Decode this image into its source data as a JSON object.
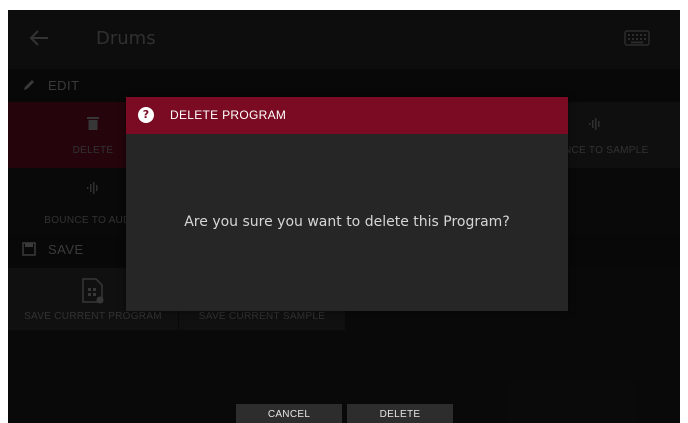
{
  "header": {
    "title": "Drums",
    "back_icon": "arrow-left-icon",
    "keyboard_icon": "keyboard-icon"
  },
  "edit": {
    "label": "EDIT",
    "icon": "pencil-icon",
    "tiles": [
      {
        "label": "DELETE",
        "icon": "trash-icon"
      },
      {
        "label": "BOUNCE TO SAMPLE",
        "icon": "waveform-icon"
      },
      {
        "label": "BOUNCE TO AUDIO",
        "icon": "waveform-icon"
      }
    ]
  },
  "save": {
    "label": "SAVE",
    "icon": "floppy-icon",
    "tiles": [
      {
        "label": "SAVE CURRENT PROGRAM",
        "icon": "program-file-icon"
      },
      {
        "label": "SAVE CURRENT SAMPLE",
        "icon": "sample-file-icon"
      }
    ]
  },
  "dialog": {
    "title": "DELETE PROGRAM",
    "help_glyph": "?",
    "message": "Are you sure you want to delete this Program?"
  },
  "buttons": {
    "cancel": "CANCEL",
    "delete": "DELETE"
  },
  "colors": {
    "accent": "#7b0b22",
    "tile_active": "#3a0812",
    "background": "#0f0f0f"
  }
}
